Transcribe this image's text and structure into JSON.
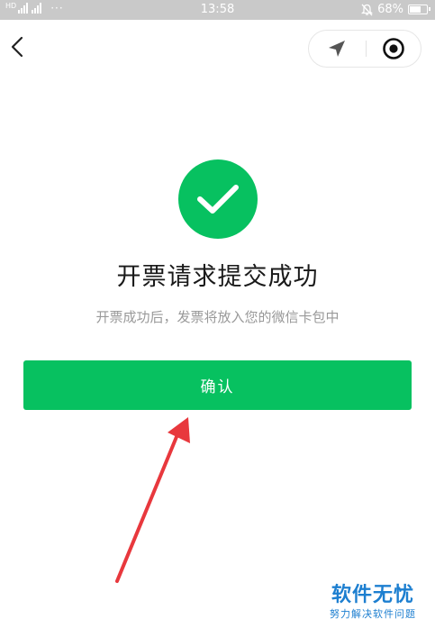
{
  "status_bar": {
    "time": "13:58",
    "battery_percent": "68%",
    "battery_level": 0.68,
    "signal_label": "HD",
    "signal_dots": "···",
    "alarm_icon": "bell-off-icon"
  },
  "nav": {
    "back_icon": "chevron-left-icon",
    "location_icon": "location-arrow-icon",
    "record_icon": "target-icon"
  },
  "result": {
    "icon": "check-circle-icon",
    "title": "开票请求提交成功",
    "subtitle": "开票成功后，发票将放入您的微信卡包中"
  },
  "actions": {
    "confirm_label": "确认"
  },
  "watermark": {
    "main": "软件无忧",
    "sub": "努力解决软件问题"
  },
  "colors": {
    "accent": "#07c160",
    "arrow": "#e8383d",
    "status_bar": "#c9c9c9",
    "watermark": "#1d7fd0"
  }
}
